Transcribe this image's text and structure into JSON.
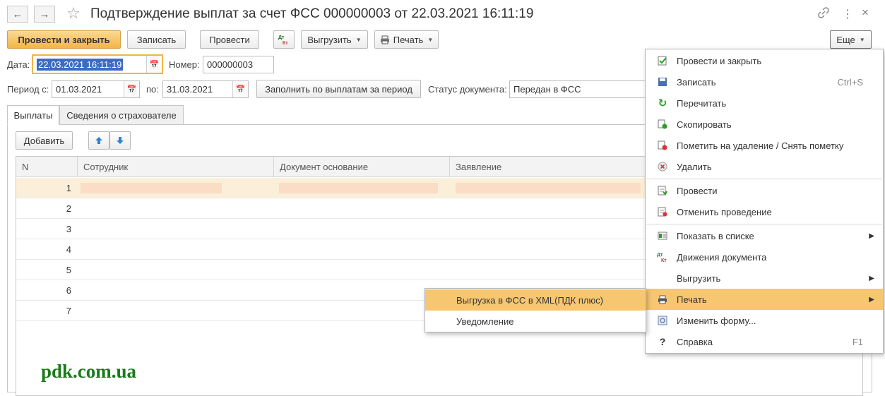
{
  "titlebar": {
    "title": "Подтверждение выплат за счет ФСС 000000003 от 22.03.2021 16:11:19",
    "back_icon": "←",
    "forward_icon": "→",
    "star_icon": "☆",
    "link_icon": "🔗",
    "more_icon": "⋮",
    "close_icon": "×"
  },
  "toolbar": {
    "post_close": "Провести и закрыть",
    "save": "Записать",
    "post": "Провести",
    "dtkt": "Дт Кт",
    "export": "Выгрузить",
    "print": "Печать",
    "more": "Еще"
  },
  "form": {
    "date_label": "Дата:",
    "date_value": "22.03.2021 16:11:19",
    "number_label": "Номер:",
    "number_value": "000000003",
    "period_from_label": "Период с:",
    "period_from_value": "01.03.2021",
    "period_to_label": "по:",
    "period_to_value": "31.03.2021",
    "fill_button": "Заполнить по выплатам за период",
    "status_label": "Статус документа:",
    "status_value": "Передан в ФСС"
  },
  "tabs": [
    {
      "label": "Выплаты",
      "active": true
    },
    {
      "label": "Сведения о страхователе",
      "active": false
    }
  ],
  "table_toolbar": {
    "add": "Добавить",
    "up_icon": "arrow-up",
    "down_icon": "arrow-down"
  },
  "table": {
    "columns": [
      "N",
      "Сотрудник",
      "Документ основание",
      "Заявление"
    ],
    "rows": [
      {
        "n": "1"
      },
      {
        "n": "2"
      },
      {
        "n": "3"
      },
      {
        "n": "4"
      },
      {
        "n": "5"
      },
      {
        "n": "6"
      },
      {
        "n": "7"
      }
    ]
  },
  "more_menu": {
    "items": [
      {
        "label": "Провести и закрыть",
        "shortcut": "",
        "icon": "post-close-icon",
        "submenu": false
      },
      {
        "label": "Записать",
        "shortcut": "Ctrl+S",
        "icon": "save-icon",
        "submenu": false
      },
      {
        "label": "Перечитать",
        "shortcut": "",
        "icon": "reload-icon",
        "submenu": false
      },
      {
        "label": "Скопировать",
        "shortcut": "",
        "icon": "copy-icon",
        "submenu": false
      },
      {
        "label": "Пометить на удаление / Снять пометку",
        "shortcut": "",
        "icon": "mark-delete-icon",
        "submenu": false
      },
      {
        "label": "Удалить",
        "shortcut": "",
        "icon": "delete-icon",
        "submenu": false
      },
      {
        "label": "Провести",
        "shortcut": "",
        "icon": "post-icon",
        "submenu": false
      },
      {
        "label": "Отменить проведение",
        "shortcut": "",
        "icon": "unpost-icon",
        "submenu": false
      },
      {
        "label": "Показать в списке",
        "shortcut": "",
        "icon": "show-list-icon",
        "submenu": true
      },
      {
        "label": "Движения документа",
        "shortcut": "",
        "icon": "dtkt-icon",
        "submenu": false
      },
      {
        "label": "Выгрузить",
        "shortcut": "",
        "icon": "",
        "submenu": true
      },
      {
        "label": "Печать",
        "shortcut": "",
        "icon": "printer-icon",
        "submenu": true,
        "highlighted": true
      },
      {
        "label": "Изменить форму...",
        "shortcut": "",
        "icon": "change-form-icon",
        "submenu": false
      },
      {
        "label": "Справка",
        "shortcut": "F1",
        "icon": "help-icon",
        "submenu": false
      }
    ]
  },
  "print_submenu": {
    "items": [
      {
        "label": "Выгрузка в ФСС в XML(ПДК плюс)",
        "highlighted": true
      },
      {
        "label": "Уведомление",
        "highlighted": false
      }
    ]
  },
  "watermark": "pdk.com.ua",
  "colors": {
    "accent": "#f2b544",
    "highlight": "#f7c670",
    "selected_row": "#fbefd9",
    "watermark": "#1a7a1a"
  }
}
